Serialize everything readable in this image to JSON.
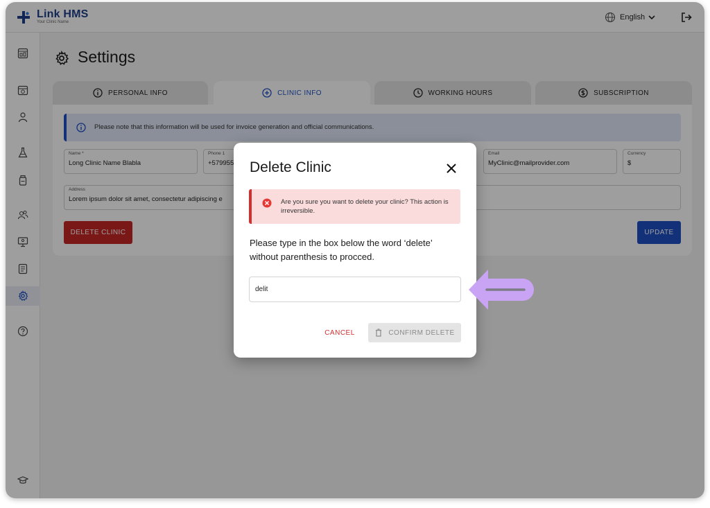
{
  "app": {
    "logo_title": "Link HMS",
    "logo_subtitle": "Your Clinic Name",
    "brand_color": "#1e3f8a",
    "language": "English"
  },
  "sidebar": {
    "items": [
      {
        "icon": "dashboard-icon",
        "active": false
      },
      {
        "icon": "calendar-icon",
        "active": false
      },
      {
        "icon": "user-icon",
        "active": false
      },
      {
        "icon": "lab-flask-icon",
        "active": false
      },
      {
        "icon": "medicine-bottle-icon",
        "active": false
      },
      {
        "icon": "staff-users-icon",
        "active": false
      },
      {
        "icon": "monitor-icon",
        "active": false
      },
      {
        "icon": "report-icon",
        "active": false
      },
      {
        "icon": "gear-icon",
        "active": true
      },
      {
        "icon": "help-icon",
        "active": false
      },
      {
        "icon": "graduation-cap-icon",
        "active": false
      }
    ]
  },
  "page": {
    "title": "Settings",
    "tabs": [
      {
        "label": "PERSONAL INFO",
        "icon": "info-circle-icon",
        "active": false
      },
      {
        "label": "CLINIC INFO",
        "icon": "plus-circle-icon",
        "active": true
      },
      {
        "label": "WORKING HOURS",
        "icon": "clock-icon",
        "active": false
      },
      {
        "label": "SUBSCRIPTION",
        "icon": "dollar-circle-icon",
        "active": false
      }
    ],
    "notice": "Please note that this information will be used for invoice generation and official communications.",
    "fields": {
      "name": {
        "label": "Name *",
        "value": "Long Clinic Name Blabla"
      },
      "phone": {
        "label": "Phone 1",
        "value": "+579955"
      },
      "email": {
        "label": "Email",
        "value": "MyClinic@mailprovider.com"
      },
      "currency": {
        "label": "Currency",
        "value": "$"
      },
      "address": {
        "label": "Address",
        "value": "Lorem ipsum dolor sit amet, consectetur adipiscing e"
      }
    },
    "delete_button": "DELETE CLINIC",
    "update_button": "UPDATE",
    "colors": {
      "danger": "#c62828",
      "primary": "#1e4fc2"
    }
  },
  "modal": {
    "title": "Delete Clinic",
    "alert": "Are you sure you want to delete your clinic? This action is irreversible.",
    "instruction": "Please type in the box below the word ‘delete’ without parenthesis to procced.",
    "input_value": "delit",
    "cancel": "CANCEL",
    "confirm": "CONFIRM DELETE",
    "pointer_color": "#c9a4f5"
  }
}
